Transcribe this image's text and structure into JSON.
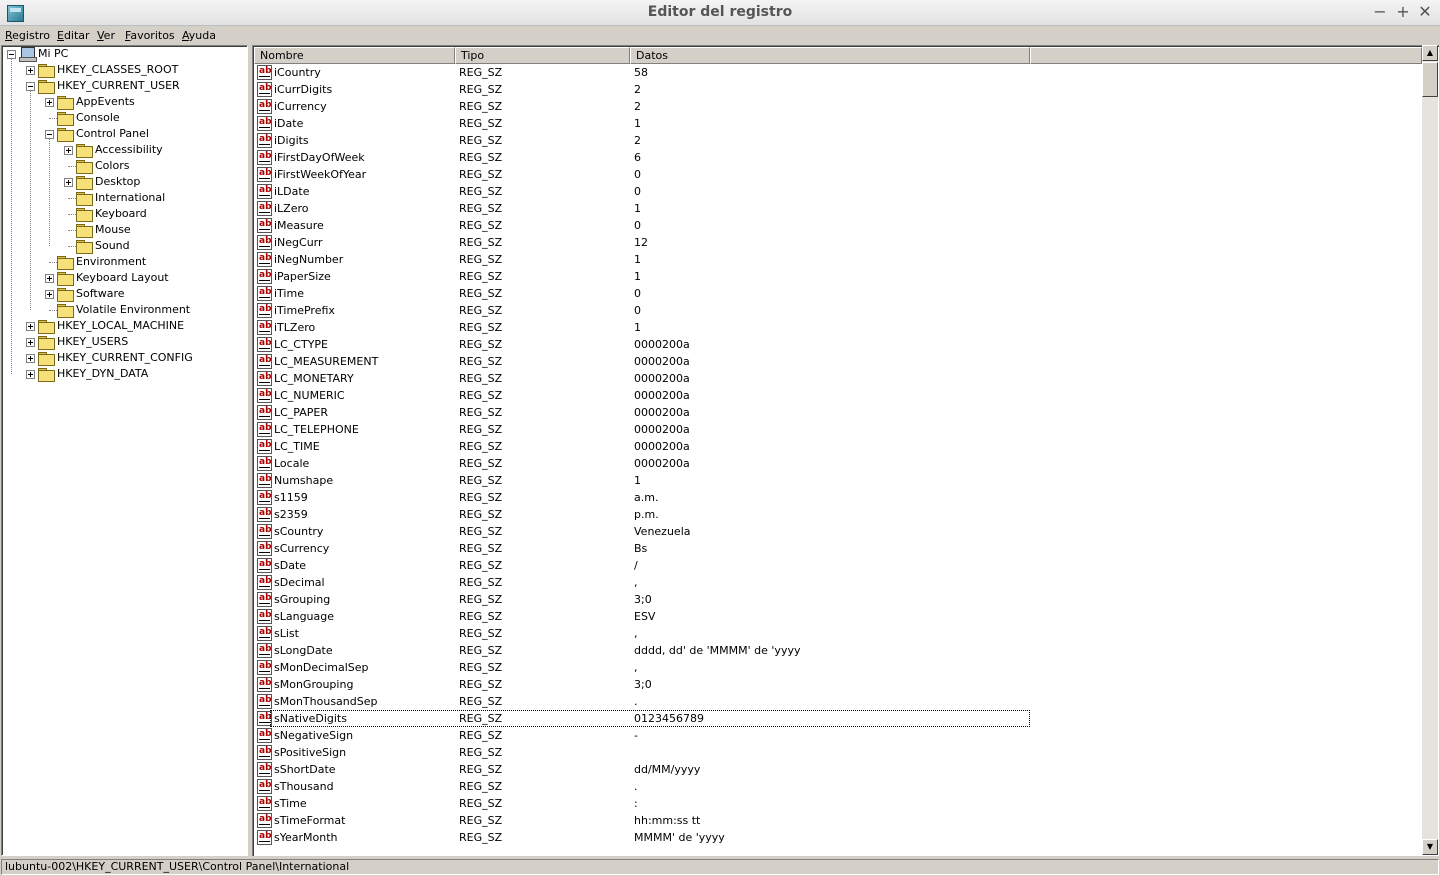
{
  "window": {
    "title": "Editor del registro"
  },
  "menu": [
    {
      "label": "Registro",
      "underline": "R",
      "rest": "egistro"
    },
    {
      "label": "Editar",
      "underline": "E",
      "rest": "ditar"
    },
    {
      "label": "Ver",
      "underline": "V",
      "rest": "er"
    },
    {
      "label": "Favoritos",
      "underline": "F",
      "rest": "avoritos"
    },
    {
      "label": "Ayuda",
      "underline": "A",
      "rest": "yuda"
    }
  ],
  "window_controls": {
    "minimize": "−",
    "maximize": "+",
    "close": "✕"
  },
  "tree": [
    {
      "label": "Mi PC",
      "level": 0,
      "expander": "minus",
      "icon": "computer-icon"
    },
    {
      "label": "HKEY_CLASSES_ROOT",
      "level": 1,
      "expander": "plus",
      "icon": "folder-icon"
    },
    {
      "label": "HKEY_CURRENT_USER",
      "level": 1,
      "expander": "minus",
      "icon": "folder-icon"
    },
    {
      "label": "AppEvents",
      "level": 2,
      "expander": "plus",
      "icon": "folder-icon"
    },
    {
      "label": "Console",
      "level": 2,
      "expander": "none",
      "icon": "folder-icon"
    },
    {
      "label": "Control Panel",
      "level": 2,
      "expander": "minus",
      "icon": "folder-icon"
    },
    {
      "label": "Accessibility",
      "level": 3,
      "expander": "plus",
      "icon": "folder-icon"
    },
    {
      "label": "Colors",
      "level": 3,
      "expander": "none",
      "icon": "folder-icon"
    },
    {
      "label": "Desktop",
      "level": 3,
      "expander": "plus",
      "icon": "folder-icon"
    },
    {
      "label": "International",
      "level": 3,
      "expander": "none",
      "icon": "open-folder-icon",
      "selected": true
    },
    {
      "label": "Keyboard",
      "level": 3,
      "expander": "none",
      "icon": "folder-icon"
    },
    {
      "label": "Mouse",
      "level": 3,
      "expander": "none",
      "icon": "folder-icon"
    },
    {
      "label": "Sound",
      "level": 3,
      "expander": "none",
      "icon": "folder-icon"
    },
    {
      "label": "Environment",
      "level": 2,
      "expander": "none",
      "icon": "folder-icon"
    },
    {
      "label": "Keyboard Layout",
      "level": 2,
      "expander": "plus",
      "icon": "folder-icon"
    },
    {
      "label": "Software",
      "level": 2,
      "expander": "plus",
      "icon": "folder-icon"
    },
    {
      "label": "Volatile Environment",
      "level": 2,
      "expander": "none",
      "icon": "folder-icon"
    },
    {
      "label": "HKEY_LOCAL_MACHINE",
      "level": 1,
      "expander": "plus",
      "icon": "folder-icon"
    },
    {
      "label": "HKEY_USERS",
      "level": 1,
      "expander": "plus",
      "icon": "folder-icon"
    },
    {
      "label": "HKEY_CURRENT_CONFIG",
      "level": 1,
      "expander": "plus",
      "icon": "folder-icon"
    },
    {
      "label": "HKEY_DYN_DATA",
      "level": 1,
      "expander": "plus",
      "icon": "folder-icon"
    }
  ],
  "list": {
    "columns": [
      "Nombre",
      "Tipo",
      "Datos"
    ],
    "value_icon": "ab",
    "rows": [
      [
        "iCountry",
        "REG_SZ",
        "58"
      ],
      [
        "iCurrDigits",
        "REG_SZ",
        "2"
      ],
      [
        "iCurrency",
        "REG_SZ",
        "2"
      ],
      [
        "iDate",
        "REG_SZ",
        "1"
      ],
      [
        "iDigits",
        "REG_SZ",
        "2"
      ],
      [
        "iFirstDayOfWeek",
        "REG_SZ",
        "6"
      ],
      [
        "iFirstWeekOfYear",
        "REG_SZ",
        "0"
      ],
      [
        "iLDate",
        "REG_SZ",
        "0"
      ],
      [
        "iLZero",
        "REG_SZ",
        "1"
      ],
      [
        "iMeasure",
        "REG_SZ",
        "0"
      ],
      [
        "iNegCurr",
        "REG_SZ",
        "12"
      ],
      [
        "iNegNumber",
        "REG_SZ",
        "1"
      ],
      [
        "iPaperSize",
        "REG_SZ",
        "1"
      ],
      [
        "iTime",
        "REG_SZ",
        "0"
      ],
      [
        "iTimePrefix",
        "REG_SZ",
        "0"
      ],
      [
        "iTLZero",
        "REG_SZ",
        "1"
      ],
      [
        "LC_CTYPE",
        "REG_SZ",
        "0000200a"
      ],
      [
        "LC_MEASUREMENT",
        "REG_SZ",
        "0000200a"
      ],
      [
        "LC_MONETARY",
        "REG_SZ",
        "0000200a"
      ],
      [
        "LC_NUMERIC",
        "REG_SZ",
        "0000200a"
      ],
      [
        "LC_PAPER",
        "REG_SZ",
        "0000200a"
      ],
      [
        "LC_TELEPHONE",
        "REG_SZ",
        "0000200a"
      ],
      [
        "LC_TIME",
        "REG_SZ",
        "0000200a"
      ],
      [
        "Locale",
        "REG_SZ",
        "0000200a"
      ],
      [
        "Numshape",
        "REG_SZ",
        "1"
      ],
      [
        "s1159",
        "REG_SZ",
        "a.m."
      ],
      [
        "s2359",
        "REG_SZ",
        "p.m."
      ],
      [
        "sCountry",
        "REG_SZ",
        "Venezuela"
      ],
      [
        "sCurrency",
        "REG_SZ",
        "Bs"
      ],
      [
        "sDate",
        "REG_SZ",
        "/"
      ],
      [
        "sDecimal",
        "REG_SZ",
        ","
      ],
      [
        "sGrouping",
        "REG_SZ",
        "3;0"
      ],
      [
        "sLanguage",
        "REG_SZ",
        "ESV"
      ],
      [
        "sList",
        "REG_SZ",
        ","
      ],
      [
        "sLongDate",
        "REG_SZ",
        "dddd, dd' de 'MMMM' de 'yyyy"
      ],
      [
        "sMonDecimalSep",
        "REG_SZ",
        ","
      ],
      [
        "sMonGrouping",
        "REG_SZ",
        "3;0"
      ],
      [
        "sMonThousandSep",
        "REG_SZ",
        "."
      ],
      [
        "sNativeDigits",
        "REG_SZ",
        "0123456789"
      ],
      [
        "sNegativeSign",
        "REG_SZ",
        "-"
      ],
      [
        "sPositiveSign",
        "REG_SZ",
        ""
      ],
      [
        "sShortDate",
        "REG_SZ",
        "dd/MM/yyyy"
      ],
      [
        "sThousand",
        "REG_SZ",
        "."
      ],
      [
        "sTime",
        "REG_SZ",
        ":"
      ],
      [
        "sTimeFormat",
        "REG_SZ",
        "hh:mm:ss tt"
      ],
      [
        "sYearMonth",
        "REG_SZ",
        "MMMM' de 'yyyy"
      ]
    ],
    "focused_row": "sNativeDigits"
  },
  "scrollbar": {
    "up": "▲",
    "down": "▼"
  },
  "status": {
    "path": "lubuntu-002\\HKEY_CURRENT_USER\\Control Panel\\International"
  }
}
